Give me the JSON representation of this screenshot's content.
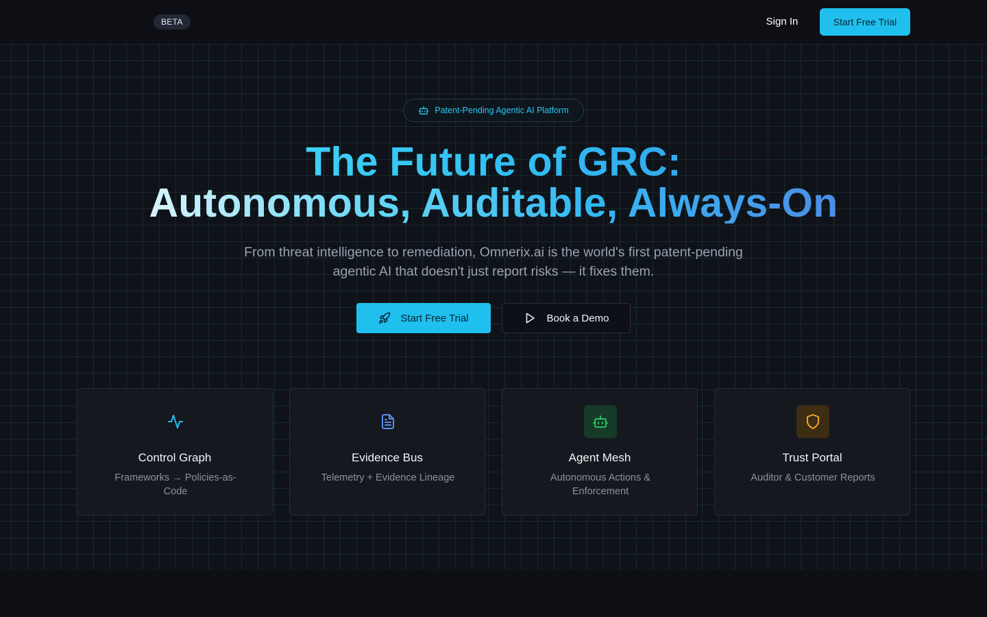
{
  "nav": {
    "badge": "BETA",
    "sign_in": "Sign In",
    "start_trial": "Start Free Trial"
  },
  "hero": {
    "pill_label": "Patent-Pending Agentic AI Platform",
    "headline_line1": "The Future of GRC:",
    "headline_line2": "Autonomous, Auditable, Always-On",
    "subheadline": "From threat intelligence to remediation, Omnerix.ai is the world's first patent-pending agentic AI that doesn't just report risks — it fixes them.",
    "cta_primary": "Start Free Trial",
    "cta_secondary": "Book a Demo"
  },
  "features": [
    {
      "title": "Control Graph",
      "description": "Frameworks → Policies-as-Code",
      "icon": "activity-icon",
      "color": "#22c3f0"
    },
    {
      "title": "Evidence Bus",
      "description": "Telemetry + Evidence Lineage",
      "icon": "document-icon",
      "color": "#5b8def"
    },
    {
      "title": "Agent Mesh",
      "description": "Autonomous Actions & Enforcement",
      "icon": "robot-icon",
      "color": "#22c55e"
    },
    {
      "title": "Trust Portal",
      "description": "Auditor & Customer Reports",
      "icon": "shield-icon",
      "color": "#f5a524"
    }
  ],
  "colors": {
    "accent": "#20c0ee",
    "background": "#0d0f14",
    "card": "#15181e"
  }
}
